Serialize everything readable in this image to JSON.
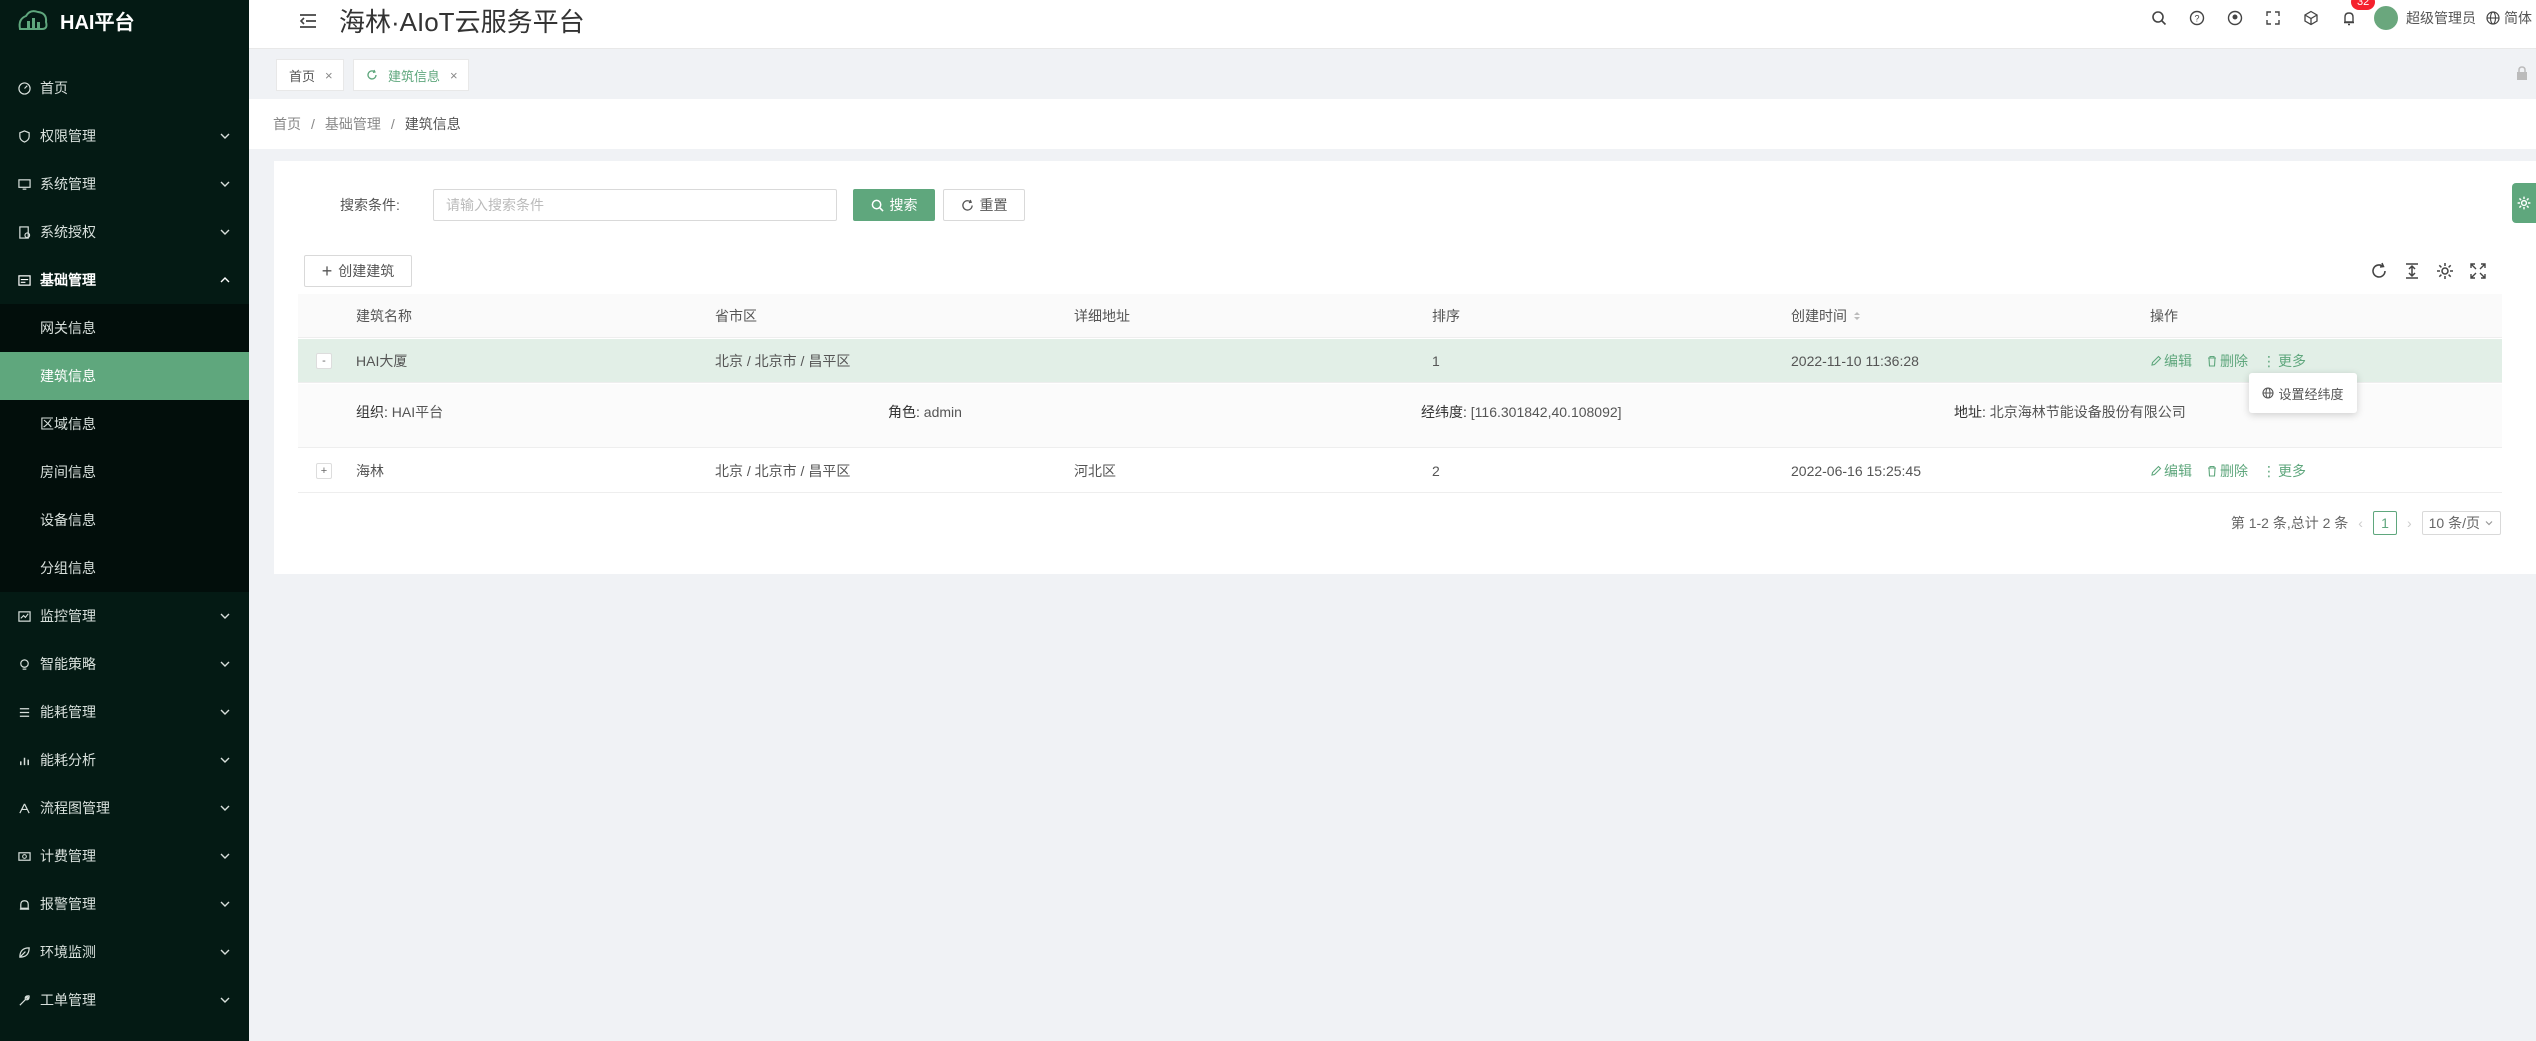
{
  "app": {
    "logo_text": "HAI平台",
    "title": "海林·AIoT云服务平台"
  },
  "header": {
    "notification_count": "32",
    "user_name": "超级管理员",
    "language": "简体"
  },
  "sidebar": {
    "items": [
      {
        "label": "首页"
      },
      {
        "label": "权限管理"
      },
      {
        "label": "系统管理"
      },
      {
        "label": "系统授权"
      },
      {
        "label": "基础管理"
      },
      {
        "label": "网关信息"
      },
      {
        "label": "建筑信息"
      },
      {
        "label": "区域信息"
      },
      {
        "label": "房间信息"
      },
      {
        "label": "设备信息"
      },
      {
        "label": "分组信息"
      },
      {
        "label": "监控管理"
      },
      {
        "label": "智能策略"
      },
      {
        "label": "能耗管理"
      },
      {
        "label": "能耗分析"
      },
      {
        "label": "流程图管理"
      },
      {
        "label": "计费管理"
      },
      {
        "label": "报警管理"
      },
      {
        "label": "环境监测"
      },
      {
        "label": "工单管理"
      }
    ]
  },
  "tabs": [
    {
      "label": "首页"
    },
    {
      "label": "建筑信息"
    }
  ],
  "breadcrumb": [
    "首页",
    "基础管理",
    "建筑信息"
  ],
  "search": {
    "label": "搜索条件:",
    "placeholder": "请输入搜索条件",
    "search_btn": "搜索",
    "reset_btn": "重置"
  },
  "toolbar": {
    "create_btn": "创建建筑"
  },
  "table": {
    "headers": [
      "建筑名称",
      "省市区",
      "详细地址",
      "排序",
      "创建时间",
      "操作"
    ],
    "rows": [
      {
        "expand": "-",
        "name": "HAI大厦",
        "region": "北京 / 北京市 / 昌平区",
        "address": "",
        "sort": "1",
        "created": "2022-11-10 11:36:28"
      },
      {
        "expand": "+",
        "name": "海林",
        "region": "北京 / 北京市 / 昌平区",
        "address": "河北区",
        "sort": "2",
        "created": "2022-06-16 15:25:45"
      }
    ],
    "actions": {
      "edit": "编辑",
      "delete": "删除",
      "more": "更多"
    },
    "detail": {
      "org_label": "组织:",
      "org_value": "HAI平台",
      "role_label": "角色:",
      "role_value": "admin",
      "geo_label": "经纬度:",
      "geo_value": "[116.301842,40.108092]",
      "addr_label": "地址:",
      "addr_value": "北京海林节能设备股份有限公司"
    },
    "popover": "设置经纬度"
  },
  "pagination": {
    "summary": "第 1-2 条,总计 2 条",
    "current": "1",
    "page_size": "10 条/页"
  },
  "colors": {
    "brand": "#5fa77d",
    "sidebar_bg": "#041a14"
  }
}
